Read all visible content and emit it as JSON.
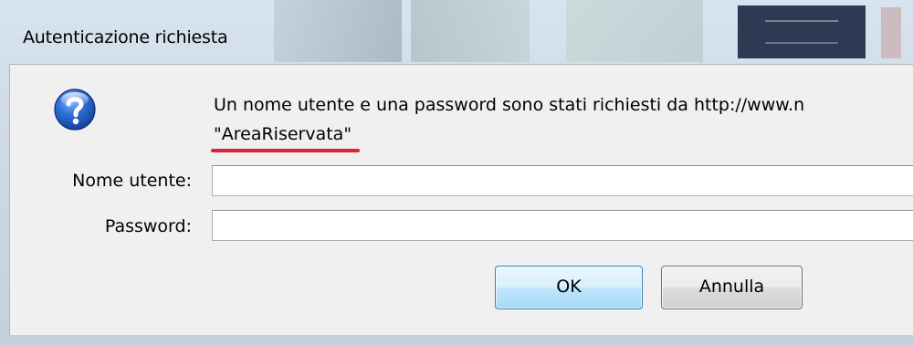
{
  "window": {
    "title": "Autenticazione richiesta"
  },
  "dialog": {
    "icon": "help-question-icon",
    "message": "Un nome utente e una password sono stati richiesti da http://www.n",
    "realm": "\"AreaRiservata\"",
    "highlight_color": "#e0213a"
  },
  "form": {
    "username_label": "Nome utente:",
    "username_value": "",
    "password_label": "Password:",
    "password_value": ""
  },
  "buttons": {
    "ok_label": "OK",
    "cancel_label": "Annulla"
  }
}
